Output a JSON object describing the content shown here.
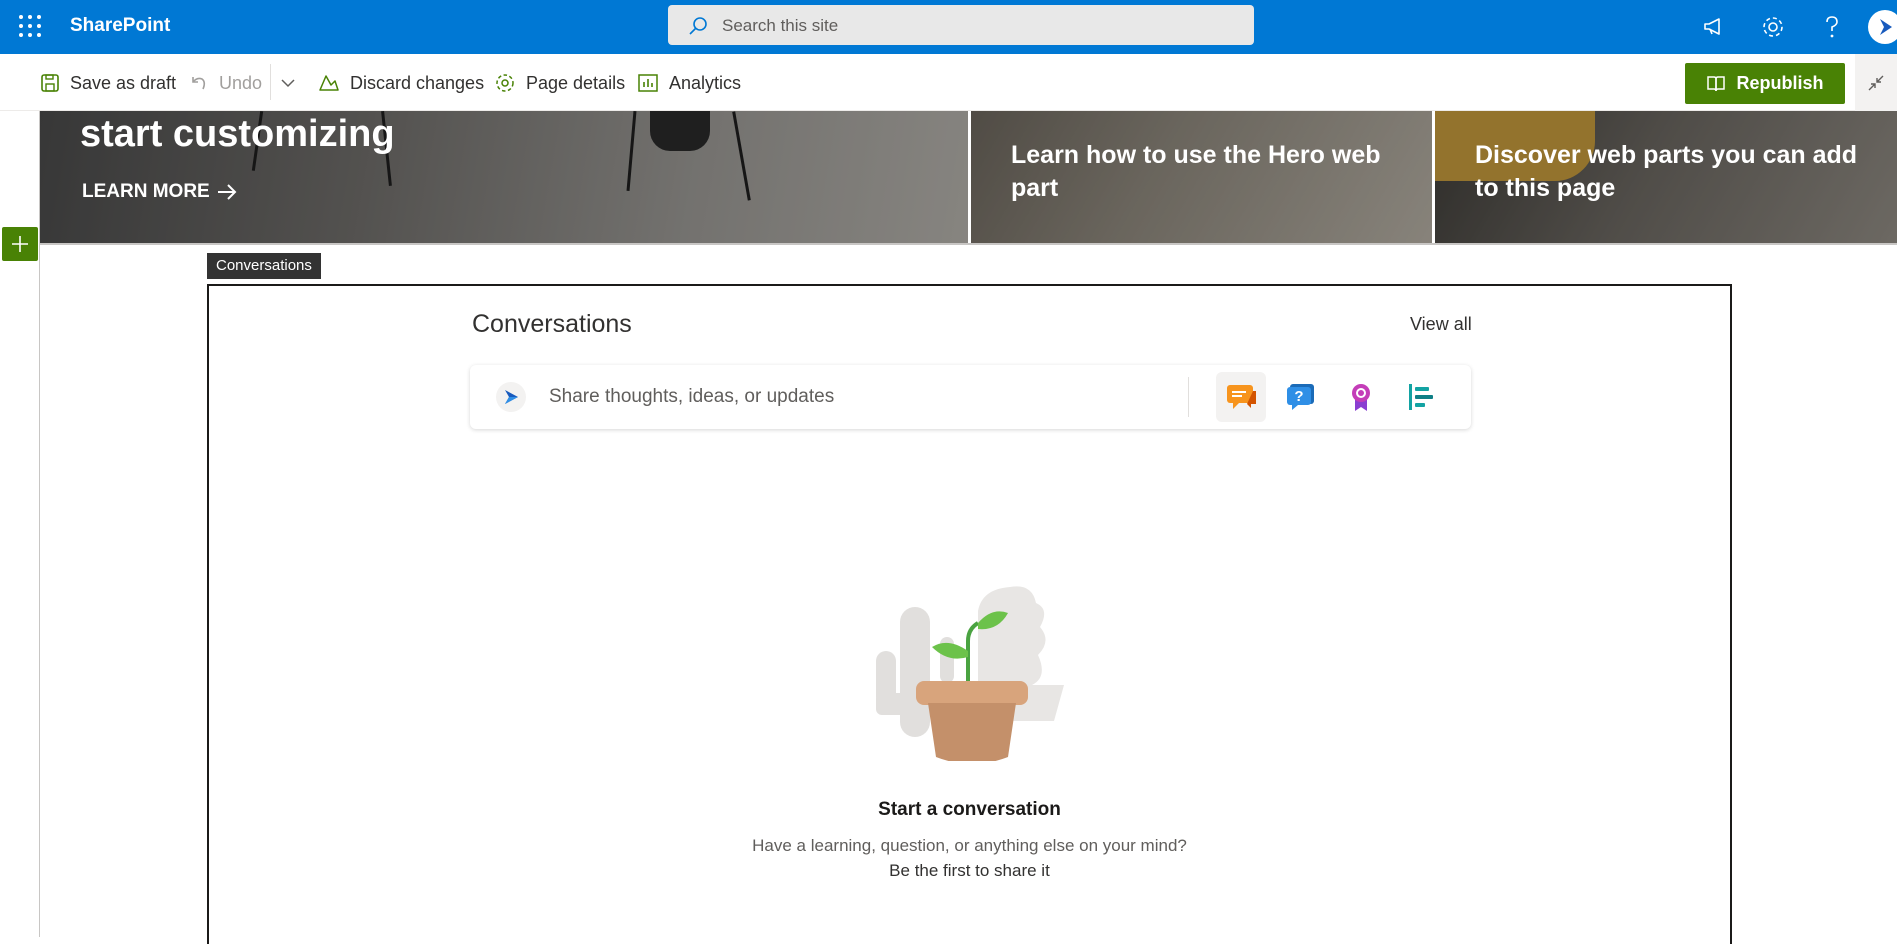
{
  "suite": {
    "app_name": "SharePoint",
    "search_placeholder": "Search this site"
  },
  "commands": {
    "save_draft": "Save as draft",
    "undo": "Undo",
    "discard": "Discard changes",
    "page_details": "Page details",
    "analytics": "Analytics",
    "republish": "Republish"
  },
  "hero": {
    "tile1_title": "start customizing",
    "tile1_link": "LEARN MORE",
    "tile2_title": "Learn how to use the Hero web part",
    "tile3_title": "Discover web parts you can add to this page"
  },
  "webpart": {
    "tag": "Conversations",
    "title": "Conversations",
    "view_all": "View all",
    "composer_placeholder": "Share thoughts, ideas, or updates",
    "composer_buttons": [
      "discussion-icon",
      "question-icon",
      "praise-icon",
      "poll-icon"
    ],
    "empty_title": "Start a conversation",
    "empty_line1": "Have a learning, question, or anything else on your mind?",
    "empty_line2": "Be the first to share it"
  },
  "colors": {
    "suite_bar": "#0078d4",
    "republish": "#498205",
    "add_section": "#498205"
  }
}
